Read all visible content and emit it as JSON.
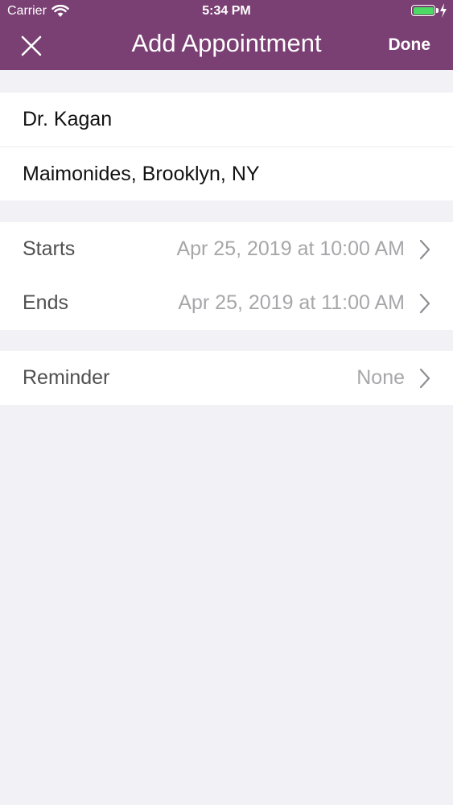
{
  "status_bar": {
    "carrier": "Carrier",
    "time": "5:34 PM",
    "battery_level": 1.0,
    "battery_color": "#4cd964"
  },
  "nav": {
    "title": "Add Appointment",
    "done_label": "Done",
    "close_icon": "close-icon",
    "background": "#7a3f73"
  },
  "details": {
    "doctor": "Dr. Kagan",
    "location": "Maimonides, Brooklyn, NY"
  },
  "schedule": {
    "starts_label": "Starts",
    "starts_value": "Apr 25, 2019 at 10:00 AM",
    "ends_label": "Ends",
    "ends_value": "Apr 25, 2019 at 11:00 AM"
  },
  "reminder": {
    "label": "Reminder",
    "value": "None"
  }
}
